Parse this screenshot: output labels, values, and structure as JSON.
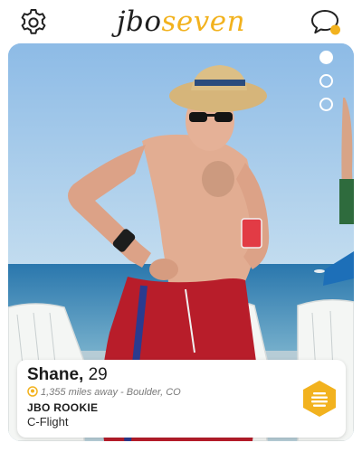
{
  "header": {
    "logo_part_a": "jbo",
    "logo_part_b": "seven",
    "settings_icon": "gear-icon",
    "messages_icon": "chat-bubble-icon"
  },
  "card": {
    "photo_index": 1,
    "photo_count": 3
  },
  "profile": {
    "name": "Shane,",
    "age": "29",
    "distance": "1,355 miles away",
    "separator": " - ",
    "location": "Boulder, CO",
    "badge": "JBO ROOKIE",
    "flight": "C-Flight"
  },
  "colors": {
    "brand_yellow": "#f2b21e",
    "text_dark": "#1c1c1c",
    "text_muted": "#7a7a7a",
    "sky": "#9cc3e8",
    "sea": "#2f7fb5",
    "shorts": "#b81d2a"
  }
}
